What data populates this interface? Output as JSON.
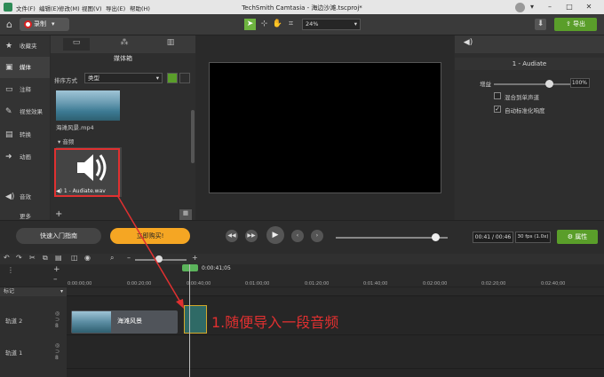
{
  "menubar": {
    "items": [
      "文件(F)",
      "编辑(E)",
      "修改(M)",
      "视图(V)",
      "导出(E)",
      "帮助(H)"
    ],
    "title": "TechSmith Camtasia - 海边沙滩.tscproj*"
  },
  "toolbar": {
    "record_label": "录制",
    "zoom_value": "24%",
    "export_label": "导出"
  },
  "sidebar": {
    "items": [
      {
        "label": "收藏夹",
        "icon": "star-icon"
      },
      {
        "label": "媒体",
        "icon": "media-icon"
      },
      {
        "label": "注释",
        "icon": "annotation-icon"
      },
      {
        "label": "视觉效果",
        "icon": "wand-icon"
      },
      {
        "label": "转换",
        "icon": "transition-icon"
      },
      {
        "label": "动画",
        "icon": "animation-icon"
      },
      {
        "label": "音效",
        "icon": "speaker-icon"
      }
    ],
    "more_label": "更多"
  },
  "media_bin": {
    "title": "媒体箱",
    "sort_label": "排序方式",
    "sort_value": "类型",
    "video_file": "海滩风景.mp4",
    "audio_section": "音频",
    "audio_file": "1 - Audiate.wav"
  },
  "properties": {
    "clip_name": "1 - Audiate",
    "gain_label": "增益",
    "gain_value": "100%",
    "gain_level": 0.72,
    "mix_mono_label": "混合到单声道",
    "mix_mono_checked": false,
    "normalize_label": "自动标准化响度",
    "normalize_checked": true
  },
  "playback": {
    "guide_label": "快速入门指南",
    "buy_label": "立即购买!",
    "time_display": "00:41 / 00:46",
    "fps_display": "30 fps (1.0x)",
    "properties_label": "属性",
    "progress": 0.89
  },
  "timeline": {
    "playhead_time": "0:00:41;05",
    "ticks": [
      "0:00:00;00",
      "0:00:20;00",
      "0:00:40;00",
      "0:01:00;00",
      "0:01:20;00",
      "0:01:40;00",
      "0:02:00;00",
      "0:02:20;00",
      "0:02:40;00"
    ],
    "marker_label": "标记",
    "tracks": [
      {
        "name": "轨道 2",
        "clip": "海滩风景"
      },
      {
        "name": "轨道 1",
        "clip": ""
      }
    ]
  },
  "annotation": {
    "text": "1.随便导入一段音频",
    "color": "#e03030"
  },
  "colors": {
    "accent_green": "#5a9e2a",
    "buy_orange": "#f5a623",
    "highlight_red": "#e03030"
  }
}
